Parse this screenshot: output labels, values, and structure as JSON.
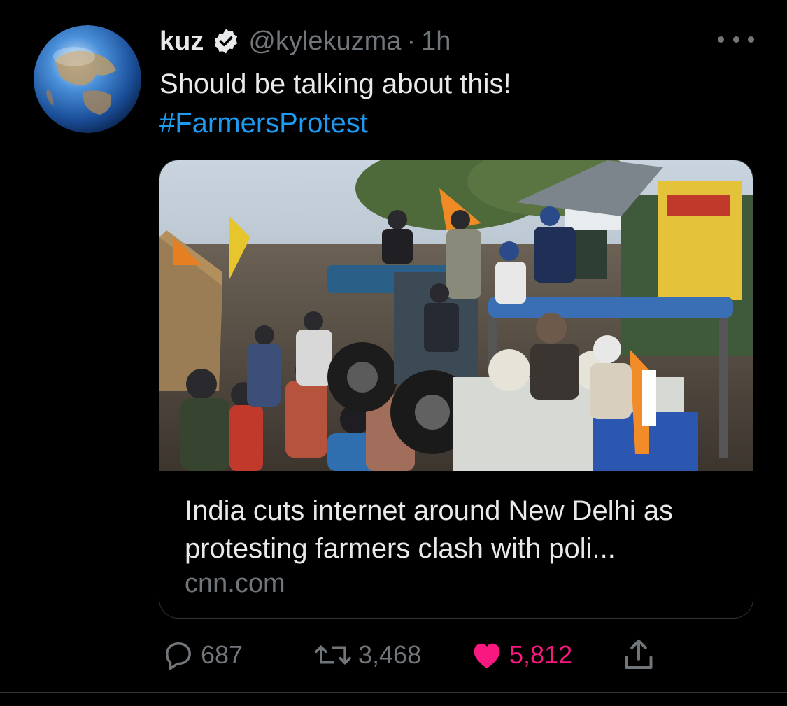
{
  "tweet": {
    "display_name": "kuz",
    "verified_icon": "verified-badge-icon",
    "handle": "@kylekuzma",
    "separator": "·",
    "time": "1h",
    "text": "Should be talking about this!",
    "hashtag": "#FarmersProtest",
    "more_icon": "more-options-icon"
  },
  "card": {
    "title": "India cuts internet around New Delhi as protesting farmers clash with poli...",
    "domain": "cnn.com",
    "image_description_icon": "news-photo"
  },
  "actions": {
    "reply_count": "687",
    "retweet_count": "3,468",
    "like_count": "5,812",
    "reply_icon": "reply-icon",
    "retweet_icon": "retweet-icon",
    "like_icon": "heart-icon",
    "share_icon": "share-icon"
  },
  "colors": {
    "background": "#000000",
    "text": "#e7e9ea",
    "secondary": "#71767b",
    "link": "#1d9bf0",
    "like": "#f91880"
  }
}
